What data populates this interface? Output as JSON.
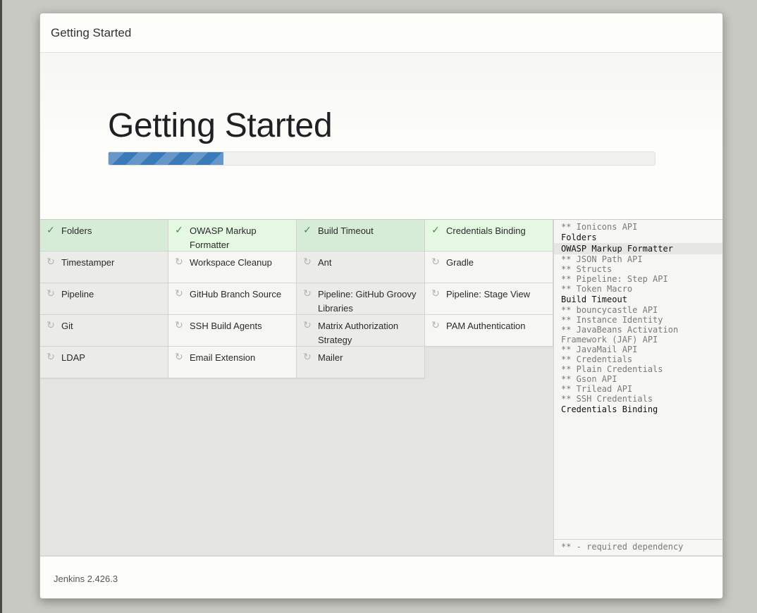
{
  "header": {
    "title": "Getting Started"
  },
  "hero": {
    "title": "Getting Started",
    "progress": 0.21
  },
  "plugins": [
    {
      "name": "Folders",
      "status": "installed"
    },
    {
      "name": "OWASP Markup Formatter",
      "status": "installed"
    },
    {
      "name": "Build Timeout",
      "status": "installed"
    },
    {
      "name": "Credentials Binding",
      "status": "installed"
    },
    {
      "name": "Timestamper",
      "status": "pending"
    },
    {
      "name": "Workspace Cleanup",
      "status": "pending"
    },
    {
      "name": "Ant",
      "status": "pending"
    },
    {
      "name": "Gradle",
      "status": "pending"
    },
    {
      "name": "Pipeline",
      "status": "pending"
    },
    {
      "name": "GitHub Branch Source",
      "status": "pending"
    },
    {
      "name": "Pipeline: GitHub Groovy Libraries",
      "status": "pending"
    },
    {
      "name": "Pipeline: Stage View",
      "status": "pending"
    },
    {
      "name": "Git",
      "status": "pending"
    },
    {
      "name": "SSH Build Agents",
      "status": "pending"
    },
    {
      "name": "Matrix Authorization Strategy",
      "status": "pending"
    },
    {
      "name": "PAM Authentication",
      "status": "pending"
    },
    {
      "name": "LDAP",
      "status": "pending"
    },
    {
      "name": "Email Extension",
      "status": "pending"
    },
    {
      "name": "Mailer",
      "status": "pending"
    }
  ],
  "log": {
    "lines": [
      {
        "text": "** Ionicons API",
        "kind": "dependency"
      },
      {
        "text": "Folders",
        "kind": "installed"
      },
      {
        "text": "OWASP Markup Formatter",
        "kind": "installed",
        "current": true
      },
      {
        "text": "** JSON Path API",
        "kind": "dependency"
      },
      {
        "text": "** Structs",
        "kind": "dependency"
      },
      {
        "text": "** Pipeline: Step API",
        "kind": "dependency"
      },
      {
        "text": "** Token Macro",
        "kind": "dependency"
      },
      {
        "text": "Build Timeout",
        "kind": "installed"
      },
      {
        "text": "** bouncycastle API",
        "kind": "dependency"
      },
      {
        "text": "** Instance Identity",
        "kind": "dependency"
      },
      {
        "text": "** JavaBeans Activation",
        "kind": "dependency"
      },
      {
        "text": "Framework (JAF) API",
        "kind": "dependency"
      },
      {
        "text": "** JavaMail API",
        "kind": "dependency"
      },
      {
        "text": "** Credentials",
        "kind": "dependency"
      },
      {
        "text": "** Plain Credentials",
        "kind": "dependency"
      },
      {
        "text": "** Gson API",
        "kind": "dependency"
      },
      {
        "text": "** Trilead API",
        "kind": "dependency"
      },
      {
        "text": "** SSH Credentials",
        "kind": "dependency"
      },
      {
        "text": "Credentials Binding",
        "kind": "installed"
      }
    ],
    "footer": "** - required dependency"
  },
  "footer": {
    "version": "Jenkins 2.426.3"
  },
  "icons": {
    "installed": "check-icon",
    "pending": "spinner-icon"
  },
  "colors": {
    "progress": "#3b7ab8",
    "installed_bg": "#d6ecd6",
    "installed_bg_alt": "#e4f8e2",
    "pending_bg": "#ebebe8"
  }
}
